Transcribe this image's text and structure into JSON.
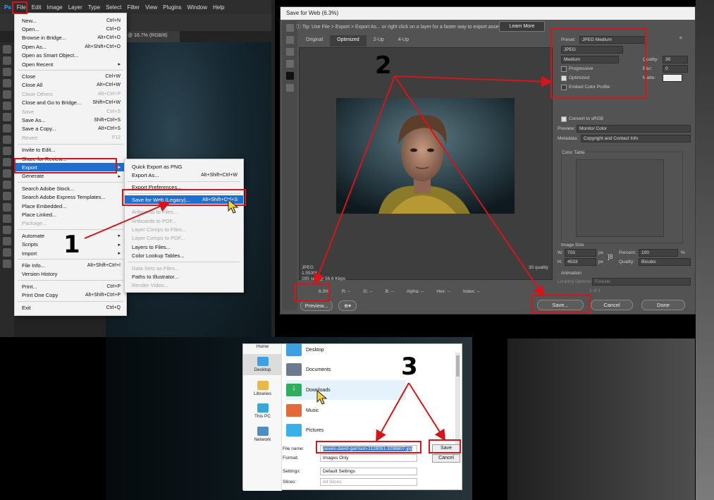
{
  "photoshop": {
    "menubar": [
      "File",
      "Edit",
      "Image",
      "Layer",
      "Type",
      "Select",
      "Filter",
      "View",
      "Plugins",
      "Window",
      "Help"
    ],
    "doc_tab": "@ 16.7% (RGB/8)",
    "file_menu": [
      {
        "label": "New...",
        "shortcut": "Ctrl+N",
        "enabled": true
      },
      {
        "label": "Open...",
        "shortcut": "Ctrl+O",
        "enabled": true
      },
      {
        "label": "Browse in Bridge...",
        "shortcut": "Alt+Ctrl+O",
        "enabled": true
      },
      {
        "label": "Open As...",
        "shortcut": "Alt+Shift+Ctrl+O",
        "enabled": true
      },
      {
        "label": "Open as Smart Object...",
        "shortcut": "",
        "enabled": true
      },
      {
        "label": "Open Recent",
        "shortcut": "▸",
        "enabled": true
      },
      {
        "label": "Close",
        "shortcut": "Ctrl+W",
        "enabled": true
      },
      {
        "label": "Close All",
        "shortcut": "Alt+Ctrl+W",
        "enabled": true
      },
      {
        "label": "Close Others",
        "shortcut": "Alt+Ctrl+P",
        "enabled": false
      },
      {
        "label": "Close and Go to Bridge...",
        "shortcut": "Shift+Ctrl+W",
        "enabled": true
      },
      {
        "label": "Save",
        "shortcut": "Ctrl+S",
        "enabled": false
      },
      {
        "label": "Save As...",
        "shortcut": "Shift+Ctrl+S",
        "enabled": true
      },
      {
        "label": "Save a Copy...",
        "shortcut": "Alt+Ctrl+S",
        "enabled": true
      },
      {
        "label": "Revert",
        "shortcut": "F12",
        "enabled": false
      },
      {
        "label": "Invite to Edit...",
        "shortcut": "",
        "enabled": true
      },
      {
        "label": "Share for Review...",
        "shortcut": "",
        "enabled": true
      },
      {
        "label": "Export",
        "shortcut": "▸",
        "enabled": true,
        "highlight": true
      },
      {
        "label": "Generate",
        "shortcut": "▸",
        "enabled": true
      },
      {
        "label": "Search Adobe Stock...",
        "shortcut": "",
        "enabled": true
      },
      {
        "label": "Search Adobe Express Templates...",
        "shortcut": "",
        "enabled": true
      },
      {
        "label": "Place Embedded...",
        "shortcut": "",
        "enabled": true
      },
      {
        "label": "Place Linked...",
        "shortcut": "",
        "enabled": true
      },
      {
        "label": "Package...",
        "shortcut": "",
        "enabled": false
      },
      {
        "label": "Automate",
        "shortcut": "▸",
        "enabled": true
      },
      {
        "label": "Scripts",
        "shortcut": "▸",
        "enabled": true
      },
      {
        "label": "Import",
        "shortcut": "▸",
        "enabled": true
      },
      {
        "label": "File Info...",
        "shortcut": "Alt+Shift+Ctrl+I",
        "enabled": true
      },
      {
        "label": "Version History",
        "shortcut": "",
        "enabled": true
      },
      {
        "label": "Print...",
        "shortcut": "Ctrl+P",
        "enabled": true
      },
      {
        "label": "Print One Copy",
        "shortcut": "Alt+Shift+Ctrl+P",
        "enabled": true
      },
      {
        "label": "Exit",
        "shortcut": "Ctrl+Q",
        "enabled": true
      }
    ],
    "export_menu": [
      {
        "label": "Quick Export as PNG",
        "shortcut": "",
        "enabled": true
      },
      {
        "label": "Export As...",
        "shortcut": "Alt+Shift+Ctrl+W",
        "enabled": true
      },
      {
        "label": "Export Preferences...",
        "shortcut": "",
        "enabled": true
      },
      {
        "label": "Save for Web (Legacy)...",
        "shortcut": "Alt+Shift+Ctrl+S",
        "enabled": true,
        "highlight": true
      },
      {
        "label": "Artboards to Files...",
        "shortcut": "",
        "enabled": false
      },
      {
        "label": "Artboards to PDF...",
        "shortcut": "",
        "enabled": false
      },
      {
        "label": "Layer Comps to Files...",
        "shortcut": "",
        "enabled": false
      },
      {
        "label": "Layer Comps to PDF...",
        "shortcut": "",
        "enabled": false
      },
      {
        "label": "Layers to Files...",
        "shortcut": "",
        "enabled": true
      },
      {
        "label": "Color Lookup Tables...",
        "shortcut": "",
        "enabled": true
      },
      {
        "label": "Data Sets as Files...",
        "shortcut": "",
        "enabled": false
      },
      {
        "label": "Paths to Illustrator...",
        "shortcut": "",
        "enabled": true
      },
      {
        "label": "Render Video...",
        "shortcut": "",
        "enabled": false
      }
    ]
  },
  "save_for_web": {
    "title": "Save for Web (6.3%)",
    "tip": "Tip: Use File > Export > Export As... or right click on a layer for a faster way to export assets",
    "learn_more": "Learn More",
    "tabs": [
      "Original",
      "Optimized",
      "2-Up",
      "4-Up"
    ],
    "active_tab": "Optimized",
    "preset_label": "Preset:",
    "preset_value": "JPEG Medium",
    "format_value": "JPEG",
    "compression_value": "Medium",
    "quality_label": "Quality:",
    "quality_value": "30",
    "blur_label": "Blur:",
    "blur_value": "0",
    "matte_label": "Matte:",
    "progressive_label": "Progressive",
    "progressive_checked": false,
    "optimized_label": "Optimized",
    "optimized_checked": true,
    "embed_label": "Embed Color Profile",
    "embed_checked": false,
    "convert_srgb_label": "Convert to sRGB",
    "convert_srgb_checked": true,
    "preview_label": "Preview:",
    "preview_value": "Monitor Color",
    "metadata_label": "Metadata:",
    "metadata_value": "Copyright and Contact Info",
    "color_table_label": "Color Table",
    "image_size_label": "Image Size",
    "w_label": "W:",
    "w_value": "703",
    "h_label": "H:",
    "h_value": "4533",
    "px": "px",
    "percent_label": "Percent:",
    "percent_value": "100",
    "percent_unit": "%",
    "resample_label": "Quality:",
    "resample_value": "Bicubic",
    "animation_label": "Animation",
    "looping_label": "Looping Options:",
    "looping_value": "Forever",
    "frame_counter": "1 of 1",
    "info_format": "JPEG",
    "info_size": "1.553M",
    "info_time": "285 sec @ 56.6 Kbps",
    "info_quality": "30 quality",
    "zoom_value": "6.3%",
    "status_r": "R: --",
    "status_g": "G: --",
    "status_b": "B: --",
    "status_alpha": "Alpha: --",
    "status_hex": "Hex: --",
    "status_index": "Index: --",
    "preview_button": "Preview...",
    "save_button": "Save...",
    "cancel_button": "Cancel",
    "done_button": "Done"
  },
  "save_dialog": {
    "nav": [
      "Home",
      "Desktop",
      "Libraries",
      "This PC",
      "Network"
    ],
    "folders": [
      "Desktop",
      "Documents",
      "Downloads",
      "Music",
      "Pictures"
    ],
    "file_name_label": "File name:",
    "file_name_value": "pexels-david-garrison-1128051-3298807.jpg",
    "format_label": "Format:",
    "format_value": "Images Only",
    "settings_label": "Settings:",
    "settings_value": "Default Settings",
    "slices_label": "Slices:",
    "slices_value": "All Slices",
    "save_button": "Save",
    "cancel_button": "Cancel"
  },
  "callouts": {
    "step1": "1",
    "step2": "2",
    "step3": "3"
  },
  "colors": {
    "accent_red": "#d4161c",
    "highlight_blue": "#1f6fd1"
  }
}
